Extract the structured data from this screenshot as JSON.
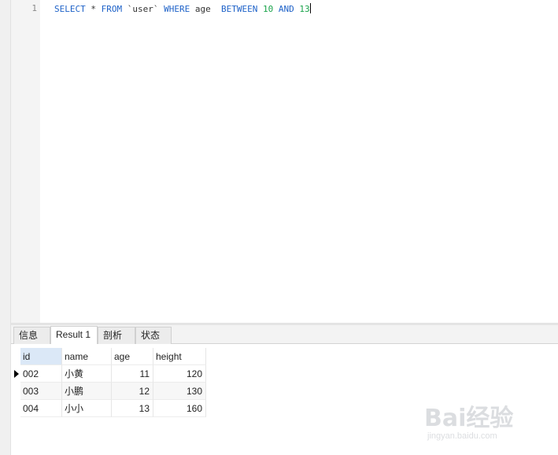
{
  "editor": {
    "line_number": "1",
    "code_tokens": [
      {
        "text": "SELECT",
        "kind": "kw"
      },
      {
        "text": " * ",
        "kind": "plain"
      },
      {
        "text": "FROM",
        "kind": "kw"
      },
      {
        "text": " `user` ",
        "kind": "plain"
      },
      {
        "text": "WHERE",
        "kind": "kw"
      },
      {
        "text": " age  ",
        "kind": "plain"
      },
      {
        "text": "BETWEEN",
        "kind": "kw"
      },
      {
        "text": " ",
        "kind": "plain"
      },
      {
        "text": "10",
        "kind": "num"
      },
      {
        "text": " ",
        "kind": "plain"
      },
      {
        "text": "AND",
        "kind": "kw"
      },
      {
        "text": " ",
        "kind": "plain"
      },
      {
        "text": "13",
        "kind": "num"
      }
    ]
  },
  "tabs": [
    {
      "label": "信息",
      "active": false
    },
    {
      "label": "Result 1",
      "active": true
    },
    {
      "label": "剖析",
      "active": false
    },
    {
      "label": "状态",
      "active": false
    }
  ],
  "table": {
    "columns": [
      "id",
      "name",
      "age",
      "height"
    ],
    "rows": [
      [
        "002",
        "小黄",
        "11",
        "120"
      ],
      [
        "003",
        "小鹏",
        "12",
        "130"
      ],
      [
        "004",
        "小小",
        "13",
        "160"
      ]
    ],
    "selected_row": 0
  },
  "watermark": {
    "logo_text": "Bai经验",
    "url_text": "jingyan.baidu.com"
  },
  "colors": {
    "keyword": "#1e62c8",
    "number": "#19a34a",
    "selected_header": "#dbe8f7"
  }
}
